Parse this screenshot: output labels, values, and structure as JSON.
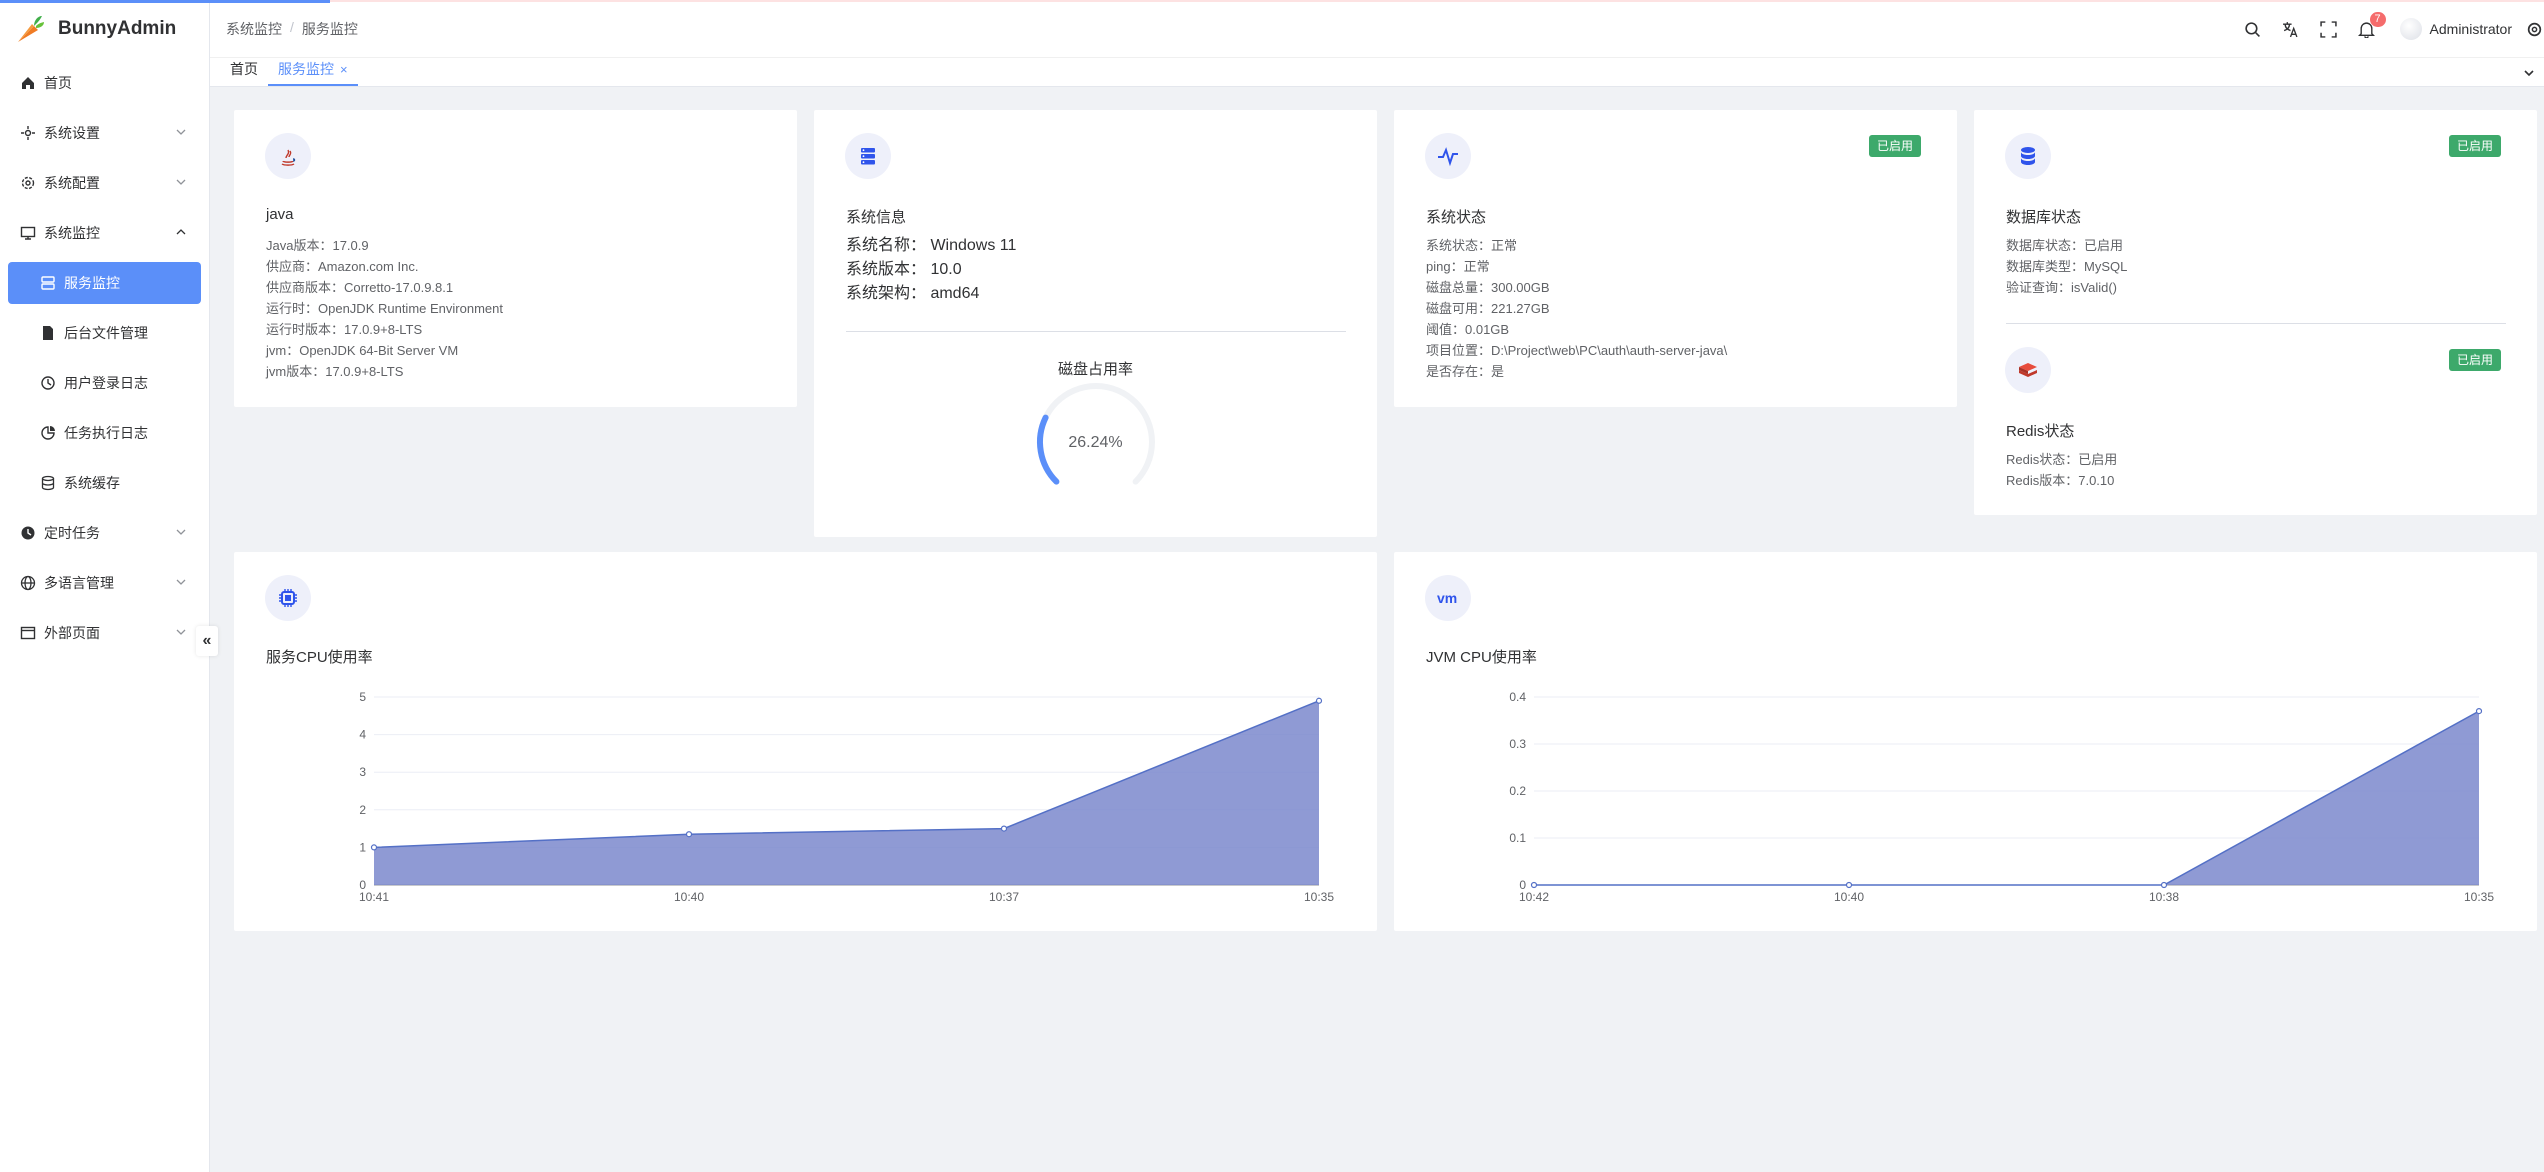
{
  "app": {
    "name": "BunnyAdmin"
  },
  "sidebar": {
    "items": [
      {
        "label": "首页",
        "icon": "home-icon"
      },
      {
        "label": "系统设置",
        "icon": "settings-icon"
      },
      {
        "label": "系统配置",
        "icon": "gear-icon"
      },
      {
        "label": "系统监控",
        "icon": "monitor-icon"
      },
      {
        "label": "服务监控",
        "icon": "server-icon"
      },
      {
        "label": "后台文件管理",
        "icon": "file-icon"
      },
      {
        "label": "用户登录日志",
        "icon": "user-log-icon"
      },
      {
        "label": "任务执行日志",
        "icon": "pie-icon"
      },
      {
        "label": "系统缓存",
        "icon": "database-icon"
      },
      {
        "label": "定时任务",
        "icon": "clock-icon"
      },
      {
        "label": "多语言管理",
        "icon": "globe-icon"
      },
      {
        "label": "外部页面",
        "icon": "window-icon"
      }
    ],
    "collapse_label": "«"
  },
  "header": {
    "breadcrumb": [
      "系统监控",
      "服务监控"
    ],
    "breadcrumb_sep": "/",
    "notification_count": "7",
    "username": "Administrator"
  },
  "tabs": [
    {
      "label": "首页"
    },
    {
      "label": "服务监控",
      "close": "×"
    }
  ],
  "java_card": {
    "title": "java",
    "lines": [
      "Java版本：17.0.9",
      "供应商：Amazon.com Inc.",
      "供应商版本：Corretto-17.0.9.8.1",
      "运行时：OpenJDK Runtime Environment",
      "运行时版本：17.0.9+8-LTS",
      "jvm：OpenJDK 64-Bit Server VM",
      "jvm版本：17.0.9+8-LTS"
    ]
  },
  "sysinfo_card": {
    "title": "系统信息",
    "lines": [
      "系统名称：  Windows 11",
      "系统版本：  10.0",
      "系统架构：  amd64"
    ],
    "disk_title": "磁盘占用率",
    "disk_percent_label": "26.24%",
    "disk_percent": 26.24
  },
  "status_card": {
    "title": "系统状态",
    "tag": "已启用",
    "lines": [
      "系统状态：正常",
      "ping：正常",
      "磁盘总量：300.00GB",
      "磁盘可用：221.27GB",
      "阈值：0.01GB",
      "项目位置：D:\\Project\\web\\PC\\auth\\auth-server-java\\",
      "是否存在：是"
    ]
  },
  "db_card": {
    "title": "数据库状态",
    "tag": "已启用",
    "lines": [
      "数据库状态：已启用",
      "数据库类型：MySQL",
      "验证查询：isValid()"
    ]
  },
  "redis_card": {
    "title": "Redis状态",
    "tag": "已启用",
    "lines": [
      "Redis状态：已启用",
      "Redis版本：7.0.10"
    ]
  },
  "colors": {
    "accent": "#5b8ff9",
    "area": "#7b88cc",
    "tag": "#3da96b"
  },
  "chart_data": [
    {
      "type": "area",
      "title": "服务CPU使用率",
      "categories": [
        "10:41",
        "10:40",
        "10:37",
        "10:35"
      ],
      "values": [
        1.0,
        1.35,
        1.5,
        4.9
      ],
      "ylim": [
        0,
        5
      ],
      "yticks": [
        "0",
        "1",
        "2",
        "3",
        "4",
        "5"
      ],
      "grid": true
    },
    {
      "type": "area",
      "title": "JVM CPU使用率",
      "categories": [
        "10:42",
        "10:40",
        "10:38",
        "10:35"
      ],
      "values": [
        0,
        0,
        0,
        0.37
      ],
      "ylim": [
        0,
        0.4
      ],
      "yticks": [
        "0",
        "0.1",
        "0.2",
        "0.3",
        "0.4"
      ],
      "grid": true
    }
  ]
}
